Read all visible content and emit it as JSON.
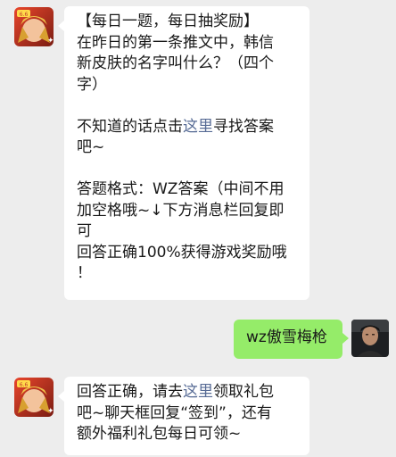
{
  "messages": [
    {
      "sender": "official",
      "avatar_icon": "game-logo-icon",
      "lines": {
        "l1": "【每日一题，每日抽奖励】",
        "l2": "在昨日的第一条推文中，韩信",
        "l3": "新皮肤的名字叫什么？（四个",
        "l4": "字）",
        "l5_before": "不知道的话点击",
        "l5_link": "这里",
        "l5_after": "寻找答案",
        "l6": "吧~",
        "l7": "答题格式：WZ答案（中间不用",
        "l8": "加空格哦~↓下方消息栏回复即",
        "l9": "可",
        "l10": "回答正确100%获得游戏奖励哦",
        "l11": "！"
      }
    },
    {
      "sender": "user",
      "avatar_icon": "user-avatar-photo",
      "text": "wz傲雪梅枪"
    },
    {
      "sender": "official",
      "avatar_icon": "game-logo-icon",
      "lines": {
        "l1_before": "回答正确，请去",
        "l1_link": "这里",
        "l1_after": "领取礼包",
        "l2": "吧~聊天框回复“签到”，还有",
        "l3": "额外福利礼包每日可领~"
      }
    }
  ],
  "colors": {
    "background": "#ededed",
    "bubble_incoming": "#ffffff",
    "bubble_outgoing": "#95ec69",
    "link": "#576b95",
    "text": "#191919"
  }
}
